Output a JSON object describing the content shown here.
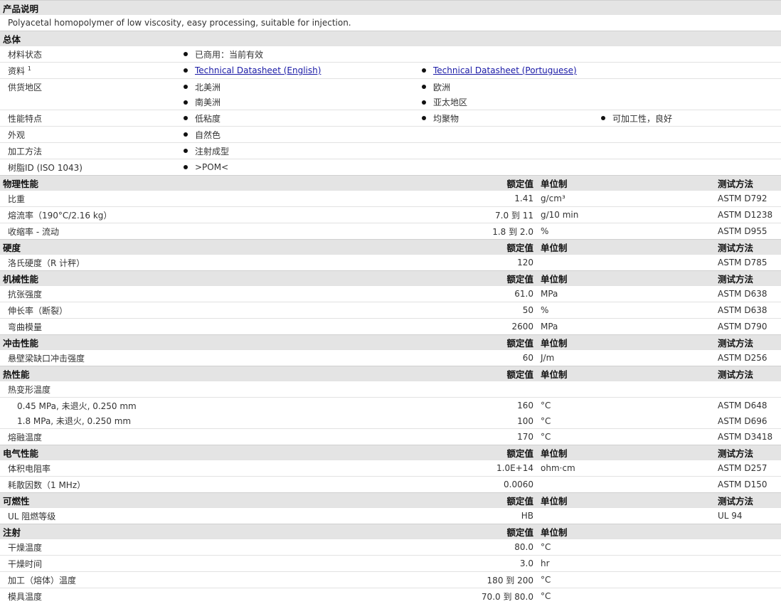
{
  "product": {
    "title": "产品说明",
    "description": "Polyacetal homopolymer of low viscosity, easy processing, suitable for injection."
  },
  "general": {
    "title": "总体",
    "status_label": "材料状态",
    "status_value": "已商用：当前有效",
    "docs_label": "资料",
    "docs_sup": "1",
    "doc1": "Technical Datasheet (English)",
    "doc2": "Technical Datasheet (Portuguese)",
    "regions_label": "供货地区",
    "region1": "北美洲",
    "region2": "欧洲",
    "region3": "南美洲",
    "region4": "亚太地区",
    "features_label": "性能特点",
    "feature1": "低粘度",
    "feature2": "均聚物",
    "feature3": "可加工性，良好",
    "appearance_label": "外观",
    "appearance_value": "自然色",
    "processing_label": "加工方法",
    "processing_value": "注射成型",
    "resin_label": "树脂ID (ISO 1043)",
    "resin_value": ">POM<"
  },
  "headers": {
    "nominal": "额定值",
    "unit": "单位制",
    "method": "测试方法"
  },
  "physical": {
    "title": "物理性能",
    "rows": [
      {
        "label": "比重",
        "value": "1.41",
        "unit": "g/cm³",
        "method": "ASTM D792"
      },
      {
        "label": "熔流率（190°C/2.16 kg）",
        "value": "7.0 到  11",
        "unit": "g/10 min",
        "method": "ASTM D1238"
      },
      {
        "label": "收缩率  - 流动",
        "value": "1.8 到  2.0",
        "unit": "%",
        "method": "ASTM D955"
      }
    ]
  },
  "hardness": {
    "title": "硬度",
    "rows": [
      {
        "label": "洛氏硬度（R 计秤）",
        "value": "120",
        "unit": "",
        "method": "ASTM D785"
      }
    ]
  },
  "mechanical": {
    "title": "机械性能",
    "rows": [
      {
        "label": "抗张强度",
        "value": "61.0",
        "unit": "MPa",
        "method": "ASTM D638"
      },
      {
        "label": "伸长率（断裂）",
        "value": "50",
        "unit": "%",
        "method": "ASTM D638"
      },
      {
        "label": "弯曲模量",
        "value": "2600",
        "unit": "MPa",
        "method": "ASTM D790"
      }
    ]
  },
  "impact": {
    "title": "冲击性能",
    "rows": [
      {
        "label": "悬壁梁缺口冲击强度",
        "value": "60",
        "unit": "J/m",
        "method": "ASTM D256"
      }
    ]
  },
  "thermal": {
    "title": "热性能",
    "hdt_label": "热变形温度",
    "rows": [
      {
        "label": "0.45 MPa, 未退火, 0.250 mm",
        "value": "160",
        "unit": "°C",
        "method": "ASTM D648"
      },
      {
        "label": "1.8 MPa, 未退火, 0.250 mm",
        "value": "100",
        "unit": "°C",
        "method": "ASTM D696"
      }
    ],
    "melt": {
      "label": "熔融温度",
      "value": "170",
      "unit": "°C",
      "method": "ASTM D3418"
    }
  },
  "electrical": {
    "title": "电气性能",
    "rows": [
      {
        "label": "体积电阻率",
        "value": "1.0E+14",
        "unit": "ohm·cm",
        "method": "ASTM D257"
      },
      {
        "label": "耗散因数（1 MHz）",
        "value": "0.0060",
        "unit": "",
        "method": "ASTM D150"
      }
    ]
  },
  "flammability": {
    "title": "可燃性",
    "rows": [
      {
        "label": "UL 阻燃等级",
        "value": "HB",
        "unit": "",
        "method": "UL 94"
      }
    ]
  },
  "injection": {
    "title": "注射",
    "rows": [
      {
        "label": "干燥温度",
        "value": "80.0",
        "unit": "°C"
      },
      {
        "label": "干燥时间",
        "value": "3.0",
        "unit": "hr"
      },
      {
        "label": "加工（熔体）温度",
        "value": "180 到  200",
        "unit": "°C"
      },
      {
        "label": "模具温度",
        "value": "70.0 到  80.0",
        "unit": "°C"
      }
    ]
  }
}
